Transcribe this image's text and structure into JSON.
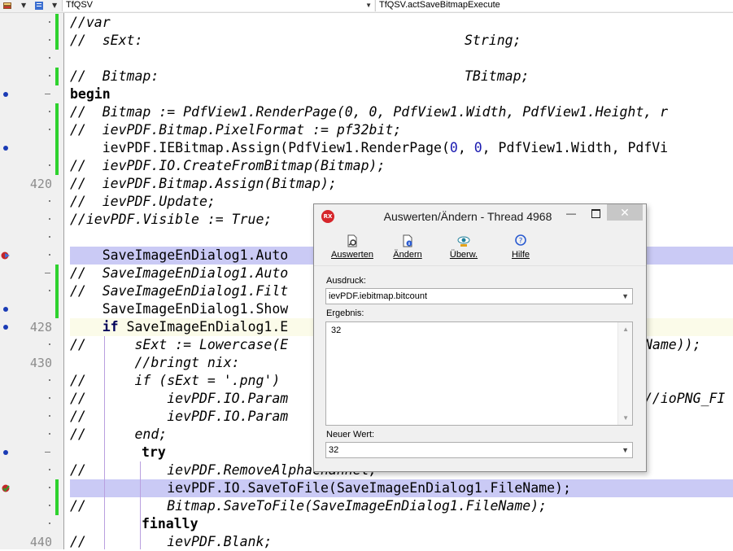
{
  "toolbar": {
    "class_combo": "TfQSV",
    "method_combo": "TfQSV.actSaveBitmapExecute"
  },
  "editor": {
    "line_numbers": [
      "420",
      "428",
      "430",
      "440"
    ],
    "lines": {
      "l1": "//var",
      "l2a": "//  sExt:",
      "l2b": "String;",
      "l4a": "//  Bitmap:",
      "l4b": "TBitmap;",
      "l5": "begin",
      "l6": "//  Bitmap := PdfView1.RenderPage(0, 0, PdfView1.Width, PdfView1.Height, r",
      "l7": "//  ievPDF.Bitmap.PixelFormat := pf32bit;",
      "l8a": "    ievPDF.IEBitmap.Assign(PdfView1.RenderPage(",
      "l8n1": "0",
      "l8c": ", ",
      "l8n2": "0",
      "l8d": ", PdfView1.Width, PdfVi",
      "l9": "//  ievPDF.IO.CreateFromBitmap(Bitmap);",
      "l10": "//  ievPDF.Bitmap.Assign(Bitmap);",
      "l11": "//  ievPDF.Update;",
      "l12": "//ievPDF.Visible := True;",
      "l14": "    SaveImageEnDialog1.Auto",
      "l15": "//  SaveImageEnDialog1.Auto",
      "l16": "//  SaveImageEnDialog1.Filt",
      "l17": "    SaveImageEnDialog1.Show",
      "l18kw": "if",
      "l18": " SaveImageEnDialog1.E",
      "l19a": "//      sExt := Lowercase(E",
      "l19b": "Name));",
      "l20": "        //bringt nix:",
      "l21": "//      if (sExt = '.png')",
      "l22a": "//          ievPDF.IO.Param",
      "l22b": "//ioPNG_FI",
      "l23": "//          ievPDF.IO.Param",
      "l24": "//      end;",
      "l25": "try",
      "l26": "//          ievPDF.RemoveAlphaChannel;",
      "l27": "            ievPDF.IO.SaveToFile(SaveImageEnDialog1.FileName);",
      "l28": "//          Bitmap.SaveToFile(SaveImageEnDialog1.FileName);",
      "l29": "finally",
      "l30": "//          ievPDF.Blank;"
    }
  },
  "dialog": {
    "title": "Auswerten/Ändern - Thread 4968",
    "app_icon_text": "RX",
    "minimize_glyph": "—",
    "close_glyph": "✕",
    "buttons": {
      "evaluate": "Auswerten",
      "modify": "Ändern",
      "watch": "Überw.",
      "help": "Hilfe"
    },
    "expression_label": "Ausdruck:",
    "expression_value": "ievPDF.iebitmap.bitcount",
    "result_label": "Ergebnis:",
    "result_value": "32",
    "new_value_label": "Neuer Wert:",
    "new_value": "32"
  },
  "colors": {
    "comment": "#207a20",
    "keyword": "#00005a",
    "number": "#1a1ab0",
    "highlight": "#cacaf5",
    "modified_marker": "#2ed22e",
    "breakpoint": "#1a3bb5"
  }
}
